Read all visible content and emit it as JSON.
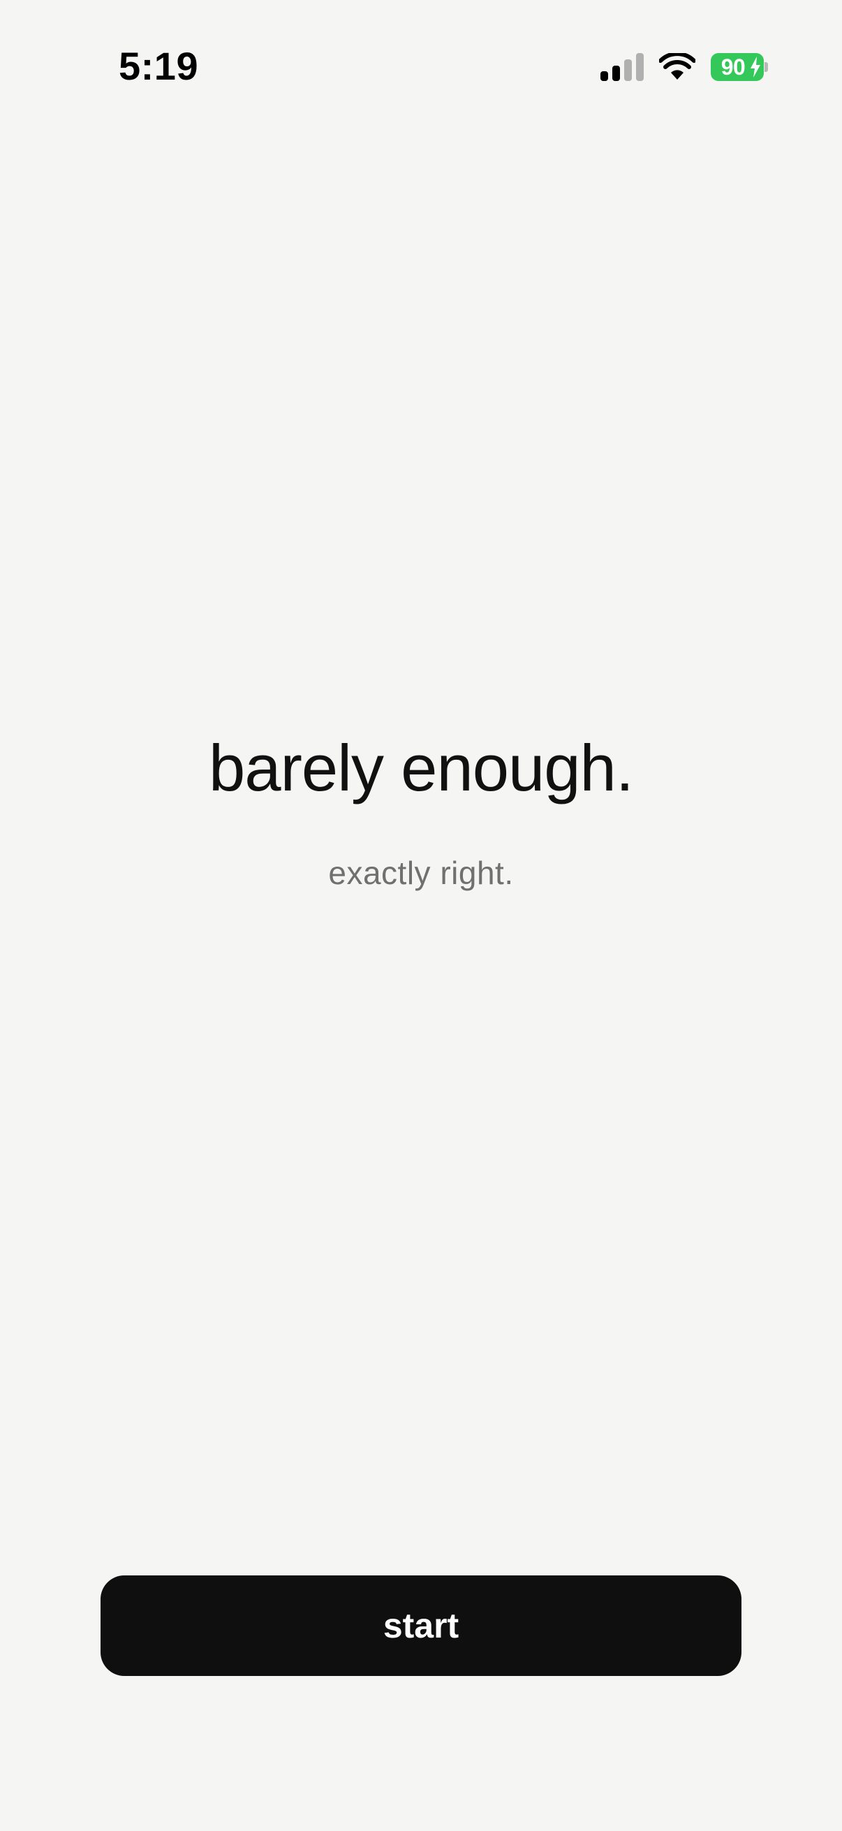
{
  "status_bar": {
    "time": "5:19",
    "battery_level": "90",
    "battery_color": "#34c759",
    "signal_icon": "cellular-signal-icon",
    "wifi_icon": "wifi-icon",
    "charging_icon": "bolt-icon"
  },
  "hero": {
    "headline": "barely enough.",
    "subline": "exactly right."
  },
  "actions": {
    "start_label": "start"
  }
}
